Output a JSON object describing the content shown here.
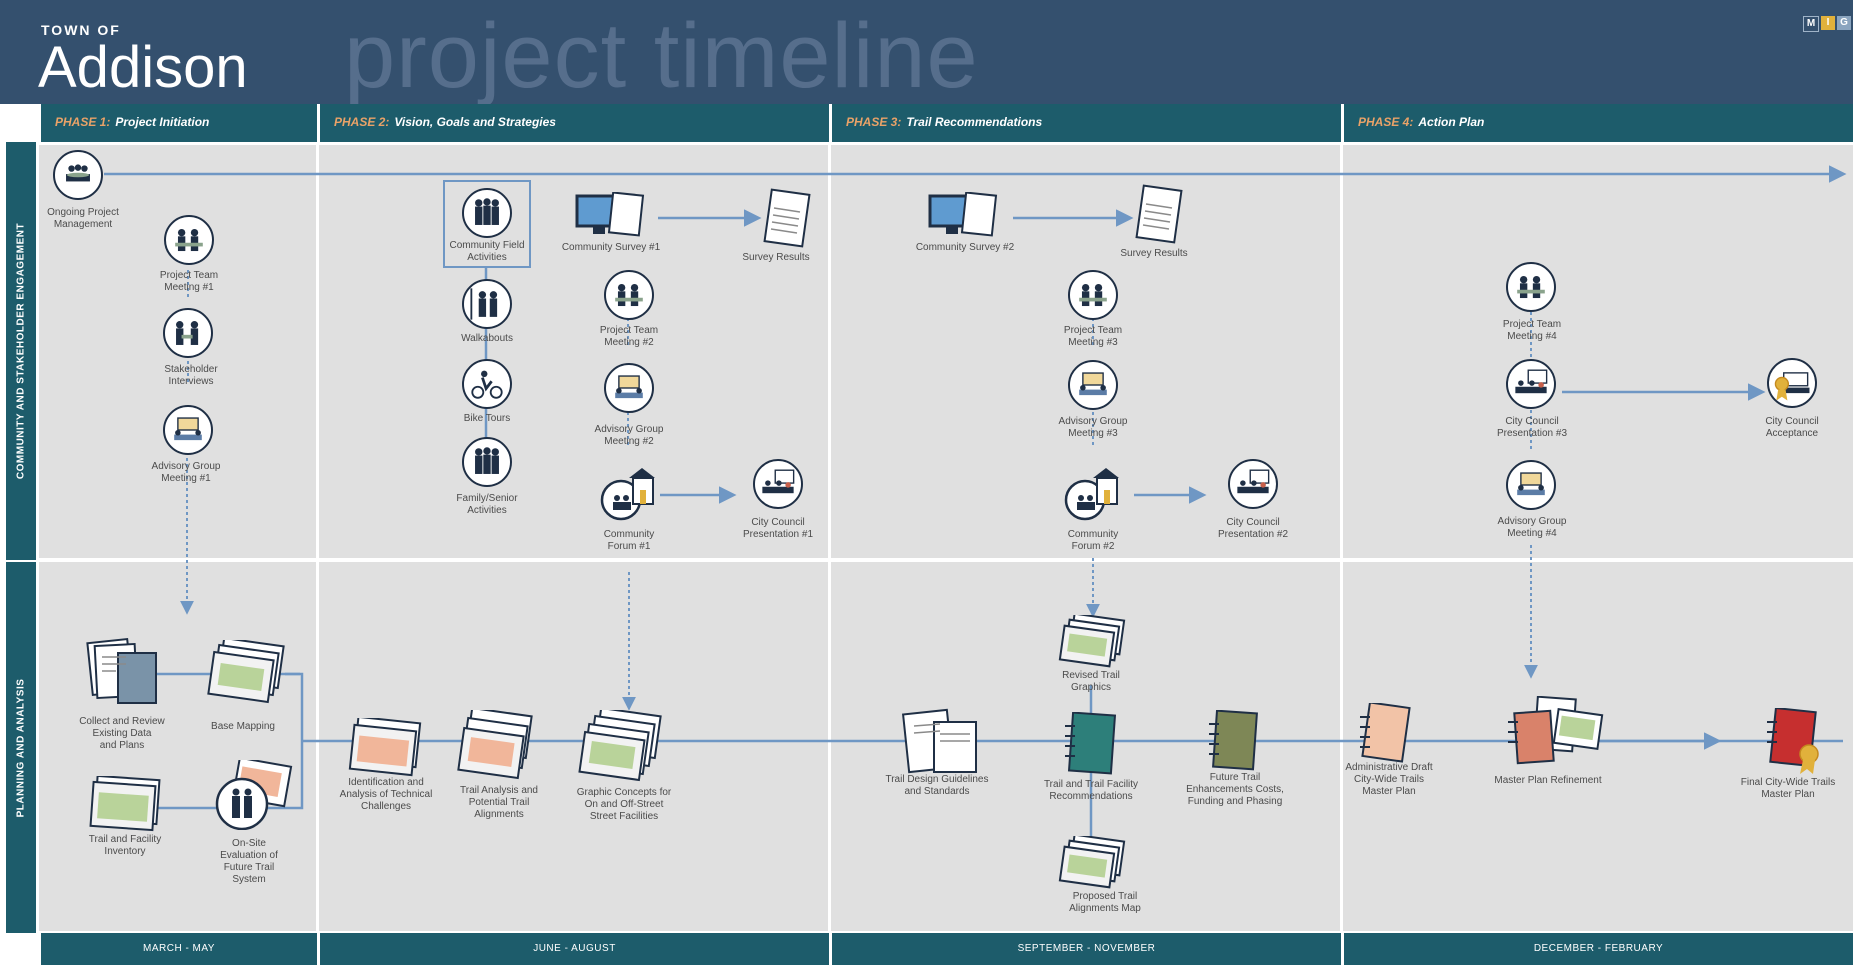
{
  "header": {
    "town_of": "TOWN OF",
    "town_name": "Addison",
    "title": "project timeline",
    "logo_letters": [
      "M",
      "I",
      "G"
    ]
  },
  "phases": [
    {
      "number": "PHASE 1:",
      "name": "Project Initiation",
      "dates": "MARCH - MAY"
    },
    {
      "number": "PHASE 2:",
      "name": "Vision, Goals and Strategies",
      "dates": "JUNE - AUGUST"
    },
    {
      "number": "PHASE 3:",
      "name": "Trail Recommendations",
      "dates": "SEPTEMBER - NOVEMBER"
    },
    {
      "number": "PHASE 4:",
      "name": "Action Plan",
      "dates": "DECEMBER - FEBRUARY"
    }
  ],
  "lanes": [
    "COMMUNITY AND STAKEHOLDER ENGAGEMENT",
    "PLANNING AND ANALYSIS"
  ],
  "engagement": {
    "ongoing": "Ongoing Project\nManagement",
    "ptm1": "Project Team\nMeeting #1",
    "stakeholder": "Stakeholder\nInterviews",
    "agm1": "Advisory Group\nMeeting #1",
    "field": "Community Field\nActivities",
    "walkabouts": "Walkabouts",
    "bike": "Bike Tours",
    "family": "Family/Senior\nActivities",
    "survey1": "Community Survey #1",
    "results1": "Survey Results",
    "ptm2": "Project Team\nMeeting #2",
    "agm2": "Advisory Group\nMeeting #2",
    "forum1": "Community\nForum #1",
    "ccp1": "City Council\nPresentation #1",
    "survey2": "Community Survey #2",
    "results2": "Survey Results",
    "ptm3": "Project Team\nMeeting #3",
    "agm3": "Advisory Group\nMeeting #3",
    "forum2": "Community\nForum #2",
    "ccp2": "City Council\nPresentation #2",
    "ptm4": "Project Team\nMeeting #4",
    "ccp3": "City Council\nPresentation #3",
    "agm4": "Advisory Group\nMeeting #4",
    "acceptance": "City Council\nAcceptance"
  },
  "planning": {
    "collect": "Collect and Review\nExisting Data\nand Plans",
    "basemap": "Base Mapping",
    "inventory": "Trail and Facility\nInventory",
    "onsite": "On-Site\nEvaluation of\nFuture Trail\nSystem",
    "challenges": "Identification and\nAnalysis of Technical\nChallenges",
    "analysis": "Trail Analysis and\nPotential Trail\nAlignments",
    "concepts": "Graphic Concepts for\nOn and Off-Street\nStreet Facilities",
    "guidelines": "Trail Design Guidelines\nand Standards",
    "revised": "Revised Trail\nGraphics",
    "recommend": "Trail and Trail Facility\nRecommendations",
    "proposed": "Proposed Trail\nAlignments Map",
    "future": "Future Trail\nEnhancements Costs,\nFunding and Phasing",
    "admin": "Administrative Draft\nCity-Wide Trails\nMaster Plan",
    "refinement": "Master Plan Refinement",
    "final": "Final City-Wide Trails\nMaster Plan"
  },
  "colors": {
    "header": "#34506e",
    "teal": "#1d5c6b",
    "cell": "#e0e0e0",
    "line": "#6f97c4",
    "phase_num": "#e9a268"
  }
}
